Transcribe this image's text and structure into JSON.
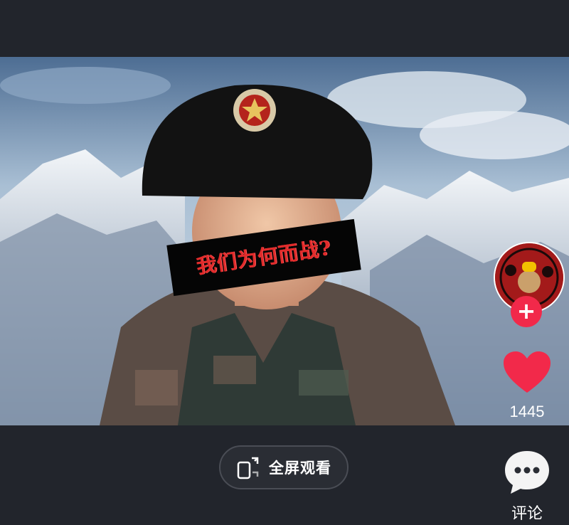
{
  "video": {
    "caption": "我们为何而战?"
  },
  "right_rail": {
    "like_count": "1445",
    "comment_label": "评论"
  },
  "bottom": {
    "fullscreen_label": "全屏观看"
  },
  "colors": {
    "background": "#22252c",
    "like_red": "#f2294a",
    "caption_red": "#e12b2b"
  },
  "icons": [
    "avatar",
    "plus-icon",
    "heart-icon",
    "fullscreen-icon",
    "comment-icon"
  ]
}
